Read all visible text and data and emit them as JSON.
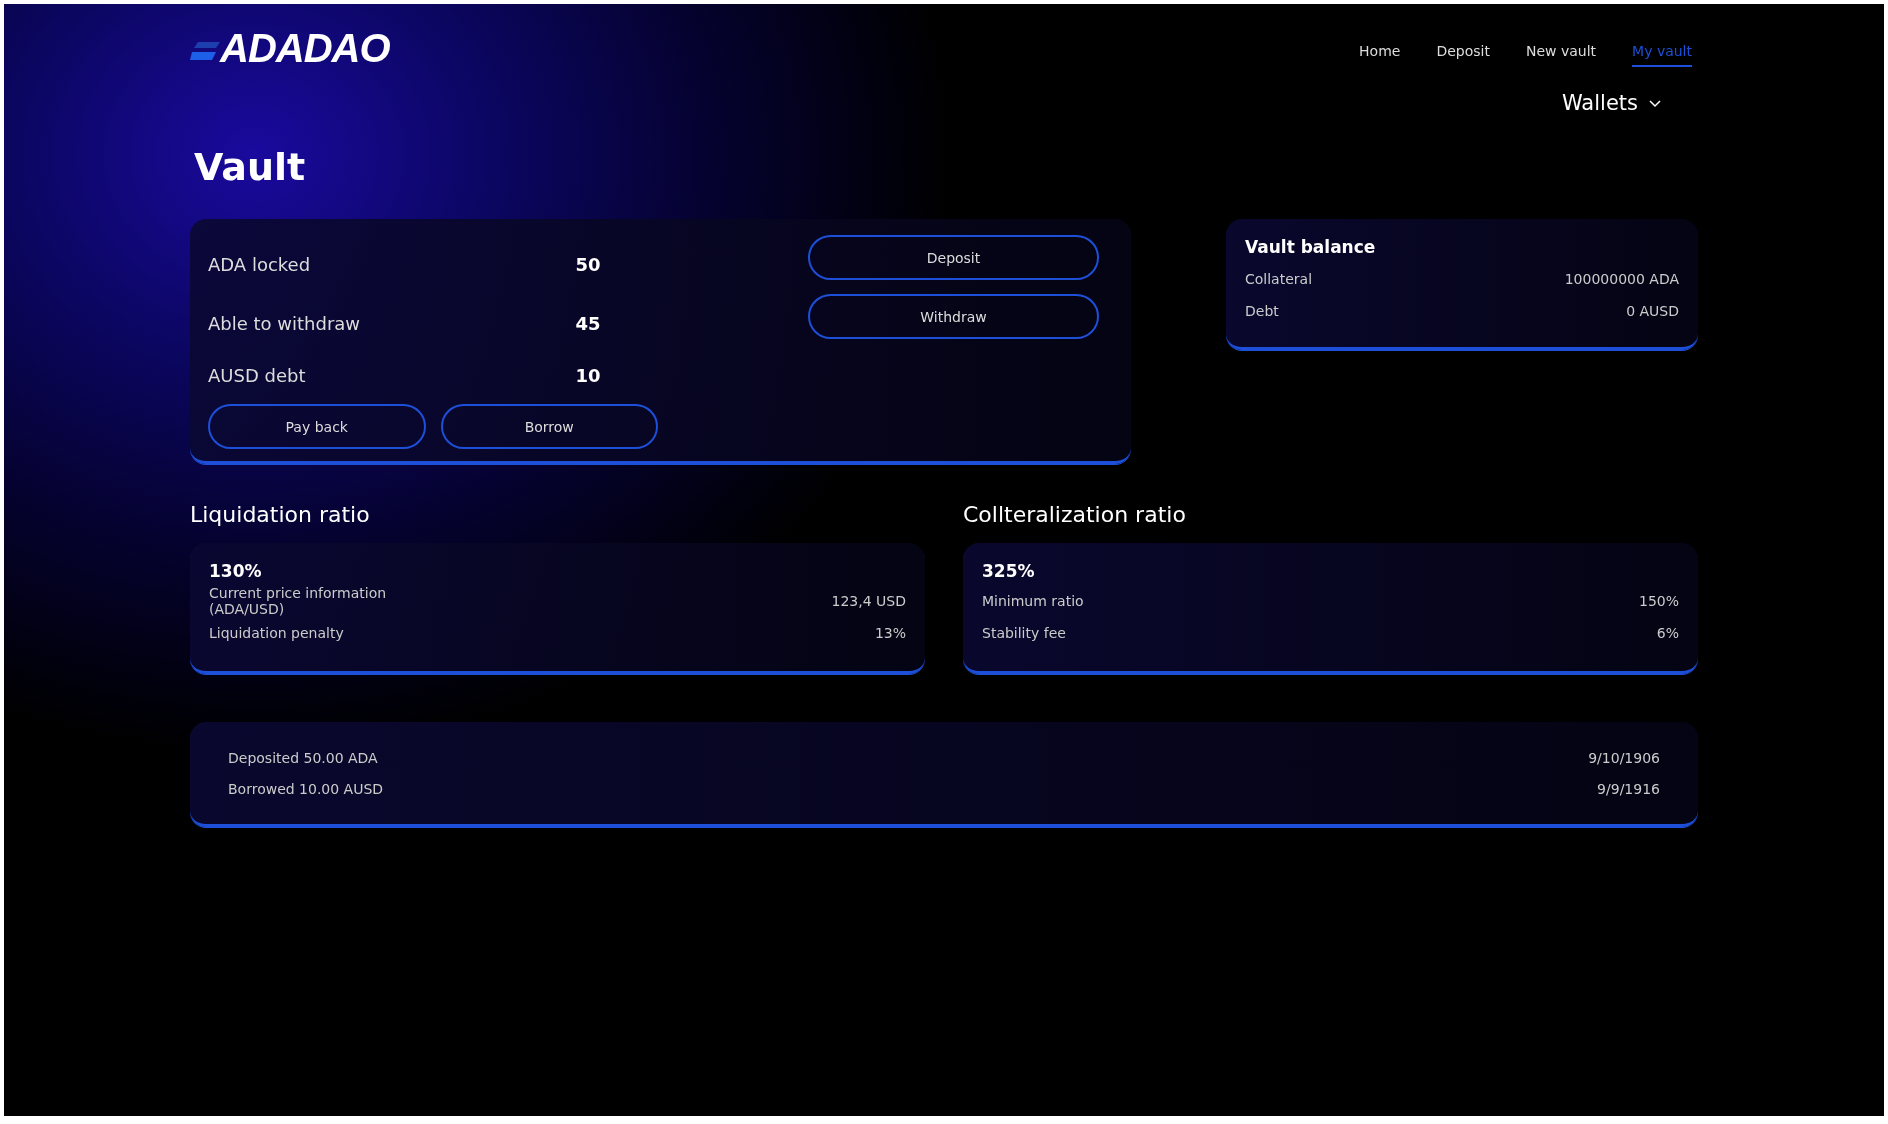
{
  "logo": {
    "text": "ADADAO"
  },
  "nav": [
    {
      "label": "Home",
      "selected": false
    },
    {
      "label": "Deposit",
      "selected": false
    },
    {
      "label": "New vault",
      "selected": false
    },
    {
      "label": "My vault",
      "selected": true
    }
  ],
  "wallets": {
    "label": "Wallets"
  },
  "page_title": "Vault",
  "vault_card": {
    "rows": [
      {
        "label": "ADA locked",
        "value": "50",
        "action": "Deposit"
      },
      {
        "label": "Able to withdraw",
        "value": "45",
        "action": "Withdraw"
      },
      {
        "label": "AUSD debt",
        "value": "10"
      }
    ],
    "buttons": [
      "Pay back",
      "Borrow"
    ]
  },
  "vault_balance": {
    "title": "Vault balance",
    "rows": [
      {
        "label": "Collateral",
        "value": "100000000 ADA"
      },
      {
        "label": "Debt",
        "value": "0 AUSD"
      }
    ]
  },
  "liquidation": {
    "heading": "Liquidation ratio",
    "value": "130%",
    "rows": [
      {
        "label": "Current price information (ADA/USD)",
        "value": "123,4 USD"
      },
      {
        "label": "Liquidation penalty",
        "value": "13%"
      }
    ]
  },
  "collateralization": {
    "heading": "Collteralization ratio",
    "value": "325%",
    "rows": [
      {
        "label": "Minimum ratio",
        "value": "150%"
      },
      {
        "label": "Stability fee",
        "value": "6%"
      }
    ]
  },
  "history": [
    {
      "text": "Deposited 50.00 ADA",
      "date": "9/10/1906"
    },
    {
      "text": "Borrowed 10.00 AUSD",
      "date": "9/9/1916"
    }
  ]
}
